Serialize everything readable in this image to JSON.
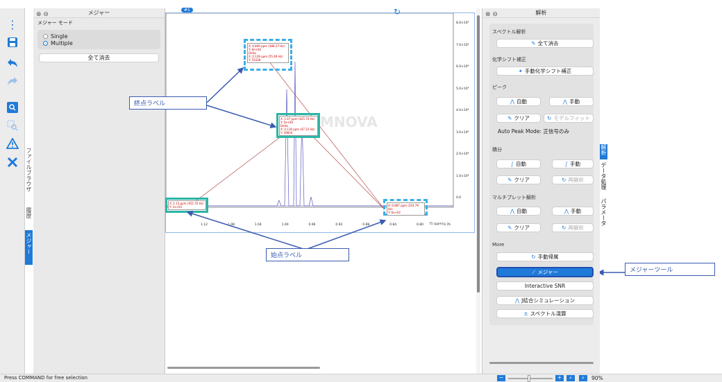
{
  "toolbar": {
    "icons": [
      "more-icon",
      "save-icon",
      "undo-icon",
      "redo-icon",
      "zoom-icon",
      "select-zoom-icon",
      "warning-icon",
      "tools-icon"
    ]
  },
  "left_tabs": [
    "ファイルブラウザ",
    "履歴",
    "メジャー"
  ],
  "measure_panel": {
    "title": "メジャー",
    "mode_label": "メジャー モード",
    "options": [
      "Single",
      "Multiple"
    ],
    "selected_option": "Multiple",
    "clear_all": "全て消去"
  },
  "spectrum": {
    "badge": "#1",
    "watermark": "MNOVA",
    "y_ticks": [
      "8.0×10⁴",
      "7.0×10⁴",
      "6.0×10⁴",
      "5.0×10⁴",
      "4.0×10⁴",
      "3.0×10⁴",
      "2.0×10⁴",
      "1.0×10⁴",
      "0.0"
    ],
    "x_ticks": [
      "1.12",
      "1.08",
      "1.04",
      "1.00",
      "0.96",
      "0.92",
      "0.88",
      "0.84",
      "0.80",
      "0.76"
    ],
    "x_unit": "f1 (ppm)",
    "labels": {
      "top": [
        "X: 0.809 ppm (388.27 Hz)",
        "Y: 6e+04",
        "Delta",
        "X: 0.139 ppm (55.49 Hz)",
        "Y: 55438"
      ],
      "middle": [
        "X: 1.07 ppm (425.70 Hz)",
        "Y: 5e+04",
        "Delta",
        "X: 0.118 ppm (47.23 Hz)",
        "Y: 39834"
      ],
      "left": [
        "X: 1.13 ppm (452.70 Hz)",
        "Y: 1e+03"
      ],
      "right": [
        "X: 0.887 ppm (354.79 Hz)",
        "Y: 6e+02"
      ]
    }
  },
  "callouts": {
    "end_label": "終点ラベル",
    "start_label": "始点ラベル",
    "measure_tool": "メジャーツール"
  },
  "analysis_panel": {
    "title": "解析",
    "sections": {
      "spectrum_analysis": "スペクトル解析",
      "chem_shift": "化学シフト補正",
      "peak": "ピーク",
      "integral": "積分",
      "multiplet": "マルチプレット解析",
      "more": "More"
    },
    "buttons": {
      "clear_all": "全て消去",
      "manual_shift": "手動化学シフト補正",
      "peak_auto": "自動",
      "peak_manual": "手動",
      "peak_clear": "クリア",
      "peak_model": "モデルフィット",
      "auto_peak_mode": "Auto Peak Mode: 正信号のみ",
      "int_auto": "自動",
      "int_manual": "手動",
      "int_clear": "クリア",
      "int_reanalyze": "再解析",
      "mp_auto": "自動",
      "mp_manual": "手動",
      "mp_clear": "クリア",
      "mp_reanalyze": "再解析",
      "manual_assign": "手動帰属",
      "measure": "メジャー",
      "snr": "Interactive SNR",
      "j_sim": "J結合シミュレーション",
      "spec_calc": "スペクトル演算"
    },
    "side_tabs": [
      "解析",
      "データ処理",
      "パラメータ"
    ]
  },
  "status": {
    "text": "Press COMMAND for free selection",
    "zoom": "90%"
  },
  "colors": {
    "accent": "#1f7ad8",
    "callout": "#3a5bb0",
    "highlight": "#2bb5a6",
    "dashed": "#3aaee8"
  }
}
